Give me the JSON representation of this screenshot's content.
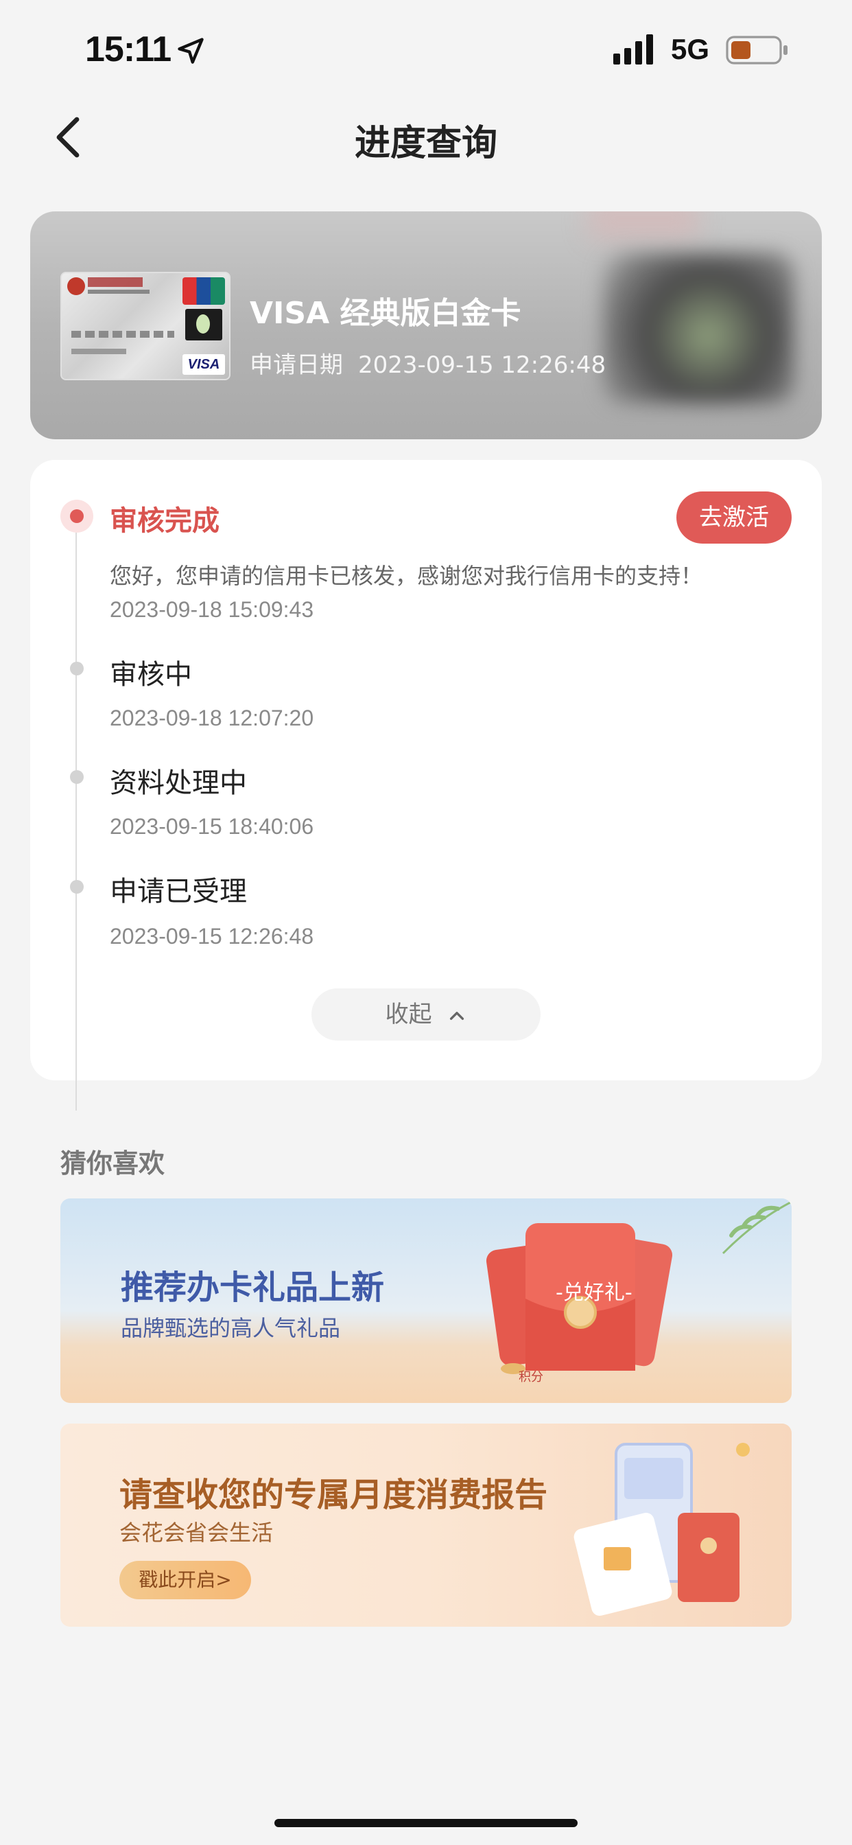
{
  "status_bar": {
    "time": "15:11",
    "network": "5G"
  },
  "nav": {
    "title": "进度查询"
  },
  "card": {
    "name": "VISA 经典版白金卡",
    "apply_label": "申请日期",
    "apply_date": "2023-09-15 12:26:48",
    "visa_mark": "VISA"
  },
  "progress": {
    "activate_label": "去激活",
    "collapse_label": "收起",
    "steps": [
      {
        "title": "审核完成",
        "desc": "您好，您申请的信用卡已核发，感谢您对我行信用卡的支持！",
        "time": "2023-09-18 15:09:43"
      },
      {
        "title": "审核中",
        "time": "2023-09-18 12:07:20"
      },
      {
        "title": "资料处理中",
        "time": "2023-09-15 18:40:06"
      },
      {
        "title": "申请已受理",
        "time": "2023-09-15 12:26:48"
      }
    ]
  },
  "recommend": {
    "title": "猜你喜欢",
    "banners": [
      {
        "title": "推荐办卡礼品上新",
        "subtitle": "品牌甄选的高人气礼品",
        "badge": "-兑好礼-",
        "points": "积分"
      },
      {
        "title": "请查收您的专属月度消费报告",
        "subtitle": "会花会省会生活",
        "button": "戳此开启>"
      }
    ]
  },
  "colors": {
    "accent": "#e05a57",
    "background": "#f4f4f4"
  }
}
